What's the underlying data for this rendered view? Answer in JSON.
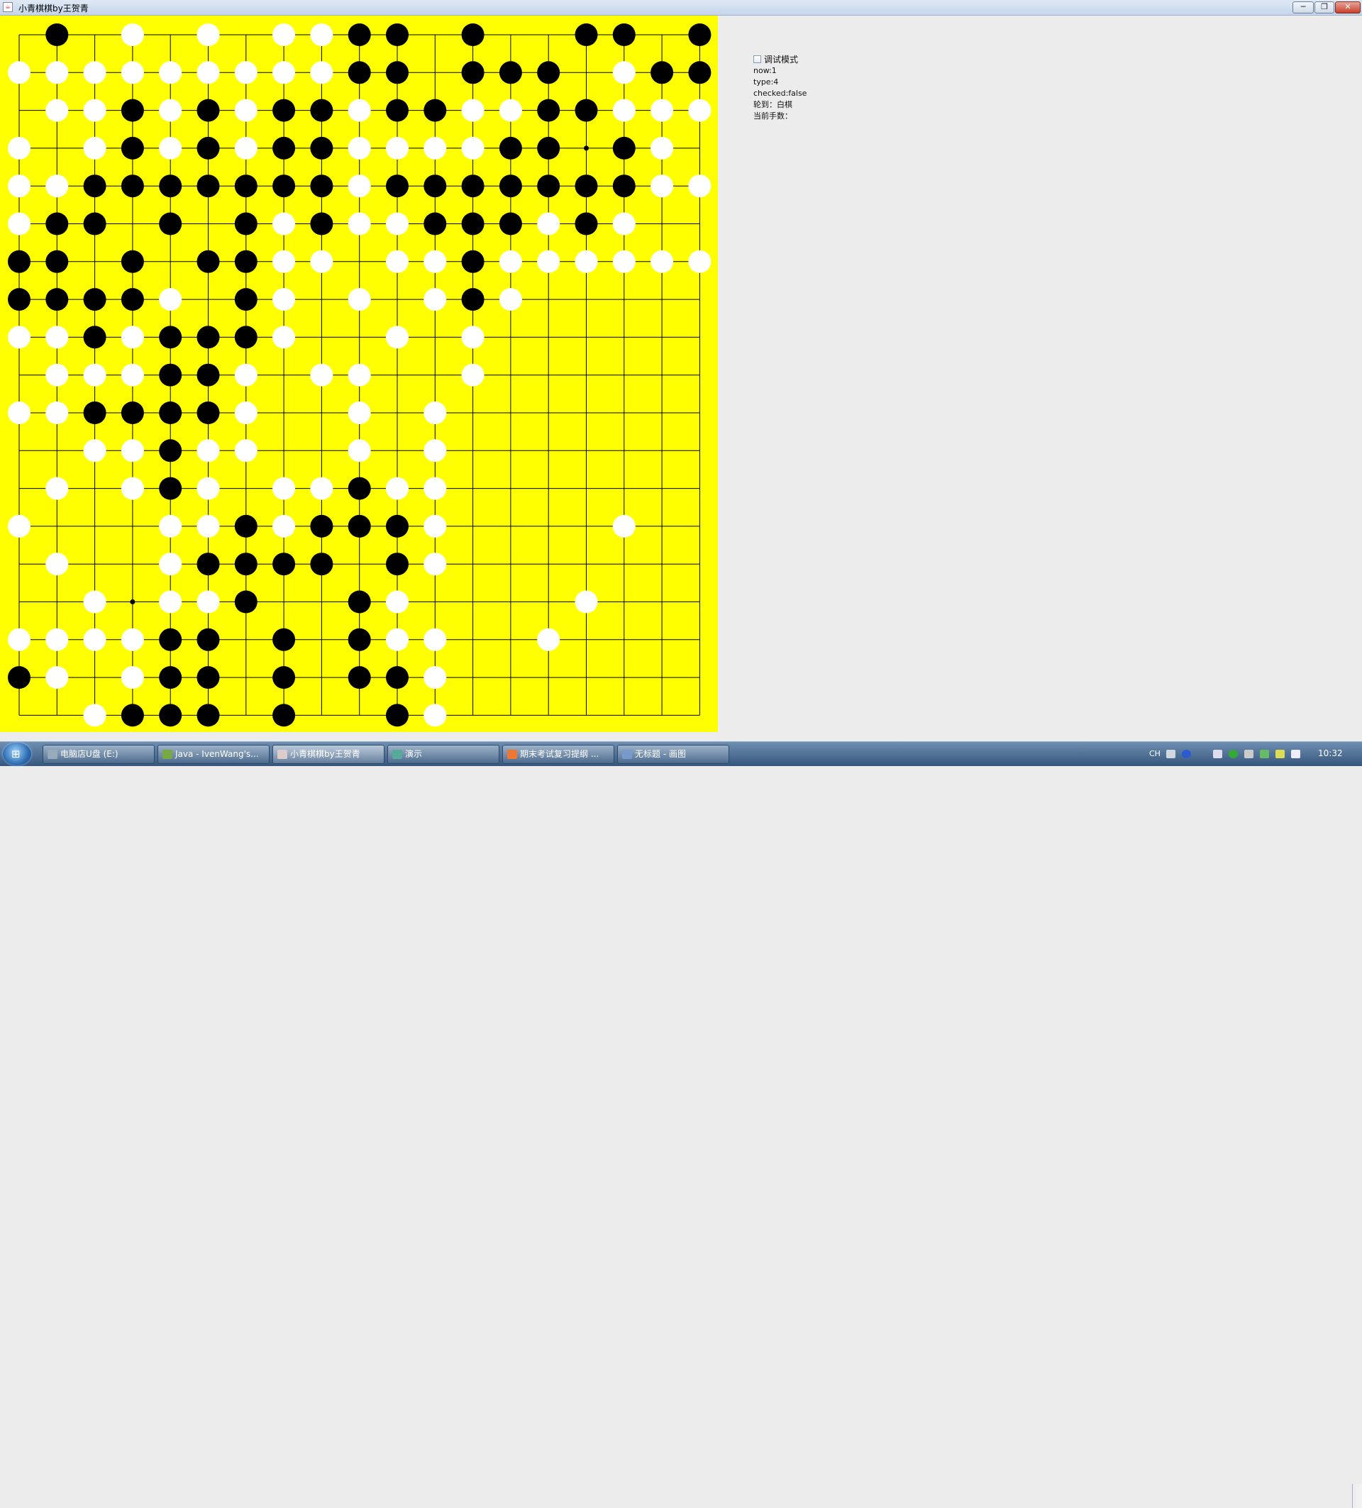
{
  "window": {
    "title": "小青棋棋by王贺青",
    "app_icon": "java-icon",
    "controls": {
      "minimize": "─",
      "maximize": "❐",
      "close": "✕"
    }
  },
  "colors": {
    "board": "#ffff00",
    "grid_line": "#000000",
    "black_stone": "#000000",
    "white_stone": "#ffffff",
    "panel_bg": "#ececec"
  },
  "board": {
    "size": 19,
    "stars": [
      [
        3,
        3
      ],
      [
        15,
        3
      ],
      [
        9,
        9
      ],
      [
        3,
        15
      ]
    ],
    "rows": [
      ".B.W.W.WWBB.B..BB.BB",
      "WWWWWWWWWBB.BBB.WBB W",
      ".WWBWBWBBWBBWWBBWWW",
      "W.WBWBWBBWWWWBB.BW.",
      "WWBBBBBBBWBBBBBBBWW",
      "WBB.B.BWBWWBBBWBW..",
      "BB.B.BBWW.WWBWWWWWW",
      "BBBBW.BW.W.WBW.....",
      "WWBWBBBW..W.W......",
      ".WWWBBW.WW..W......",
      "WWBBBBW..W.W.......",
      "..WWBWW..W.W.......",
      ".W.WBW.WWBWW.......",
      "W...WWBWBBBW....W..",
      ".W..WBBBB.BW.......",
      "..W.WWB..BW....W...",
      "WWWWBB.B.BWW..W....",
      "BW.WBB.B.BBW.......",
      "..WBBB.B..BW......."
    ]
  },
  "panel": {
    "debug_label": "调试模式",
    "debug_checked": false,
    "now": "now:1",
    "type": "type:4",
    "checked": "checked:false",
    "turn": "轮到：白棋",
    "moves": "当前手数："
  },
  "taskbar": {
    "start_icon": "windows-logo-icon",
    "items": [
      {
        "label": "电脑店U盘 (E:)",
        "icon": "drive-icon",
        "color": "#9ab"
      },
      {
        "label": "Java - IvenWang's...",
        "icon": "eclipse-icon",
        "color": "#7a4"
      },
      {
        "label": "小青棋棋by王贺青",
        "icon": "java-icon",
        "color": "#dcc",
        "active": true
      },
      {
        "label": "演示",
        "icon": "window-icon",
        "color": "#5a9"
      },
      {
        "label": "期末考试复习提纲 ...",
        "icon": "browser-icon",
        "color": "#e73"
      },
      {
        "label": "无标题 - 画图",
        "icon": "paint-icon",
        "color": "#79c"
      }
    ],
    "tray_lang": "CH",
    "clock": "10:32"
  }
}
